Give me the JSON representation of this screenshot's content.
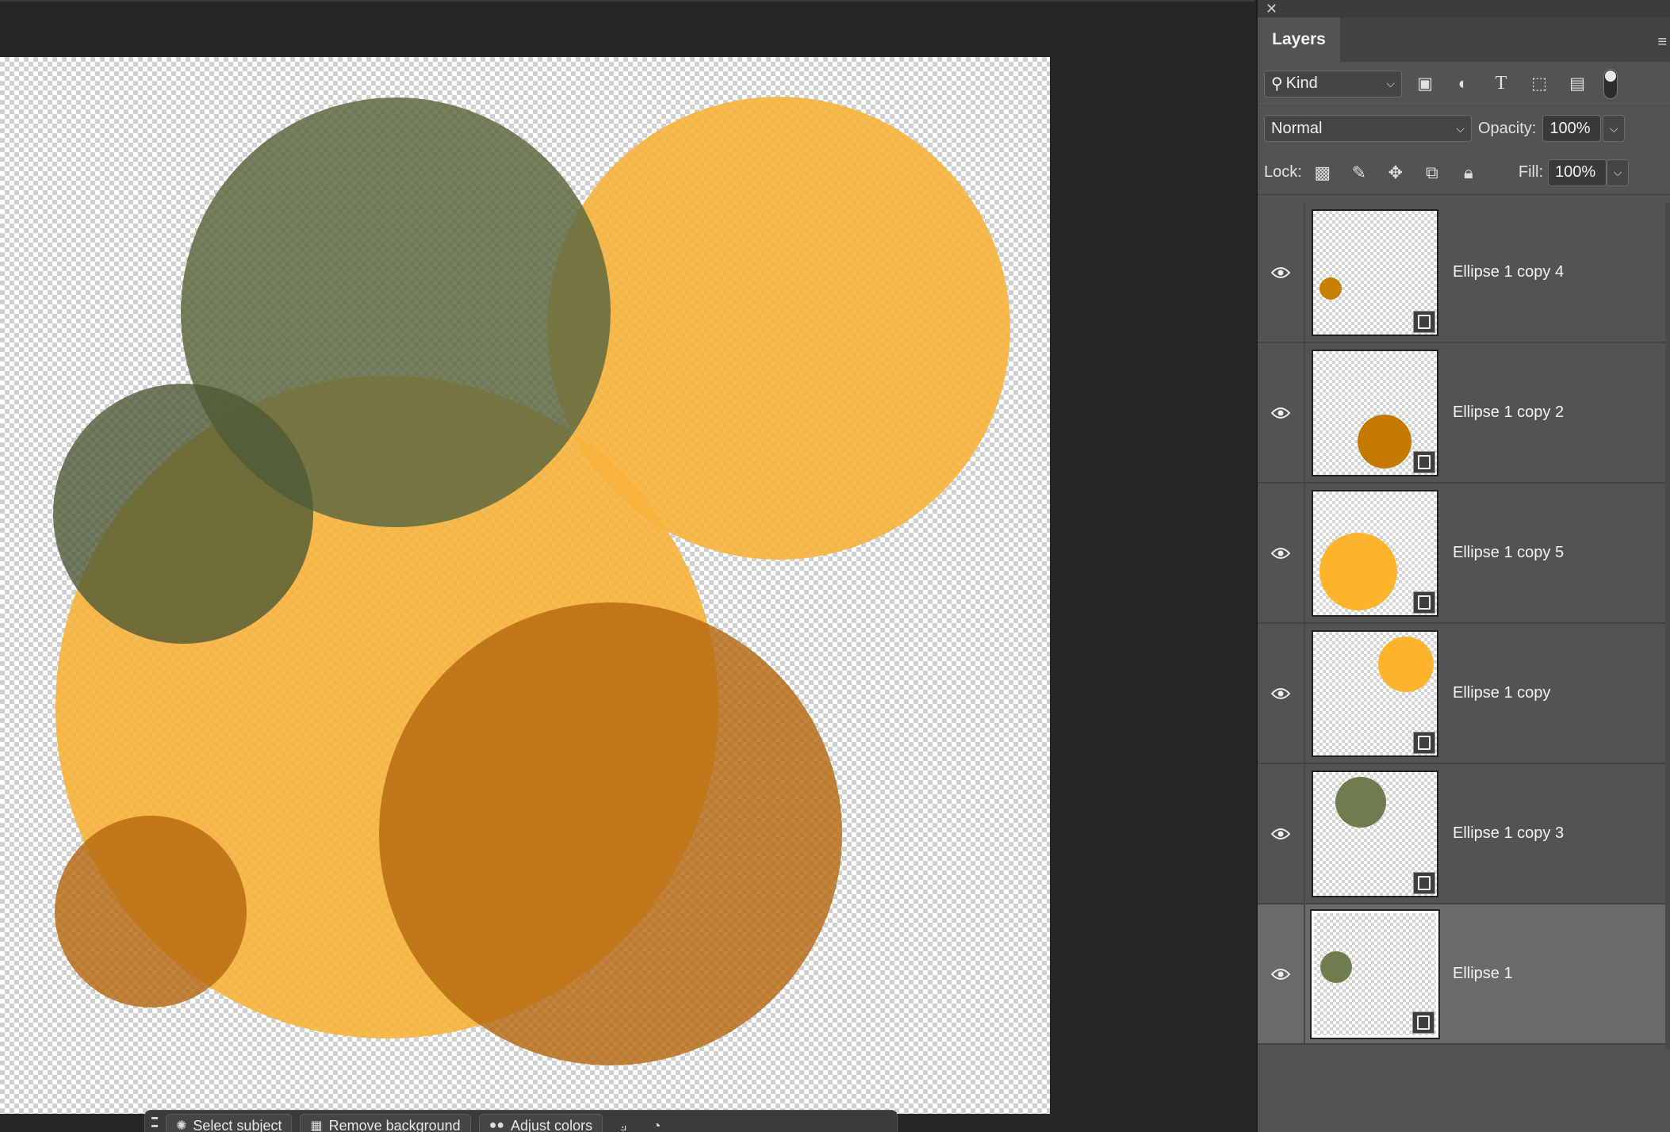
{
  "panel": {
    "close_glyph": "✕",
    "tab_label": "Layers",
    "filter": {
      "kind_label": "Kind"
    },
    "blend_mode": "Normal",
    "opacity_label": "Opacity:",
    "opacity_value": "100%",
    "lock_label": "Lock:",
    "fill_label": "Fill:",
    "fill_value": "100%"
  },
  "layers": [
    {
      "name": "Ellipse 1 copy 4",
      "visible": true,
      "selected": false,
      "thumb_color": "#c98000"
    },
    {
      "name": "Ellipse 1 copy 2",
      "visible": true,
      "selected": false,
      "thumb_color": "#c47a00"
    },
    {
      "name": "Ellipse 1 copy 5",
      "visible": true,
      "selected": false,
      "thumb_color": "#fdb42b"
    },
    {
      "name": "Ellipse 1 copy",
      "visible": true,
      "selected": false,
      "thumb_color": "#fdb42b"
    },
    {
      "name": "Ellipse 1 copy 3",
      "visible": true,
      "selected": false,
      "thumb_color": "#6f7c4d"
    },
    {
      "name": "Ellipse 1",
      "visible": true,
      "selected": true,
      "thumb_color": "#6f7c4d"
    }
  ],
  "taskbar": {
    "select_subject": "Select subject",
    "remove_background": "Remove background",
    "adjust_colors": "Adjust colors"
  },
  "colors": {
    "olive": "#5e6a40",
    "orange_light": "#f7b33e",
    "orange_dark": "#b7721d",
    "panel_bg": "#535353",
    "workspace_bg": "#262626"
  }
}
